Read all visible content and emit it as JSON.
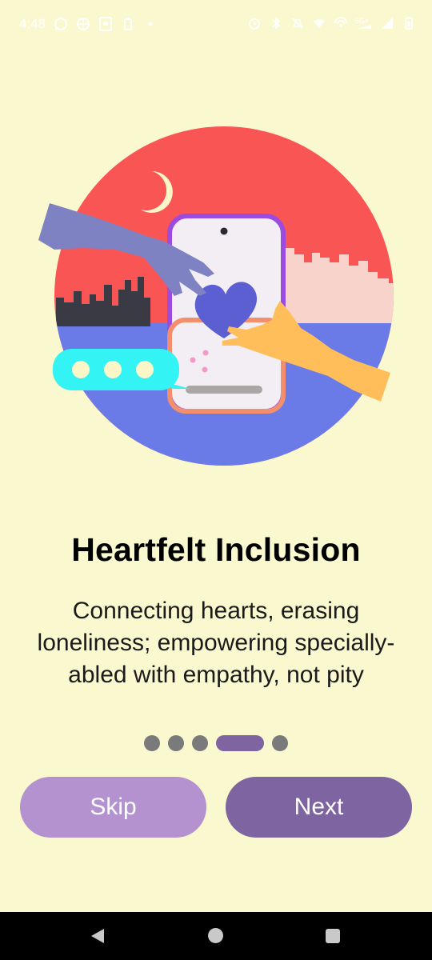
{
  "status_bar": {
    "time": "4:48",
    "left_icons": [
      "whatsapp-icon",
      "vpn-globe-icon",
      "screenshot-icon",
      "battery-saver-icon",
      "dot-icon"
    ],
    "right_icons": [
      "alarm-icon",
      "bluetooth-icon",
      "mute-icon",
      "wifi-off-icon",
      "hotspot-icon",
      "5g-signal-icon",
      "signal-icon",
      "battery-icon"
    ],
    "network_label": "5G+"
  },
  "onboarding": {
    "title": "Heartfelt Inclusion",
    "subtitle": "Connecting hearts, erasing loneliness; empowering specially-abled with empathy, not pity",
    "page_count": 5,
    "current_page": 4
  },
  "buttons": {
    "skip_label": "Skip",
    "next_label": "Next"
  },
  "colors": {
    "background": "#FAF8CF",
    "accent": "#7E64A0",
    "skip": "#B392CF",
    "indicator_inactive": "#7A7A7A"
  },
  "nav_bar": {
    "icons": [
      "back-icon",
      "home-icon",
      "recents-icon"
    ]
  }
}
